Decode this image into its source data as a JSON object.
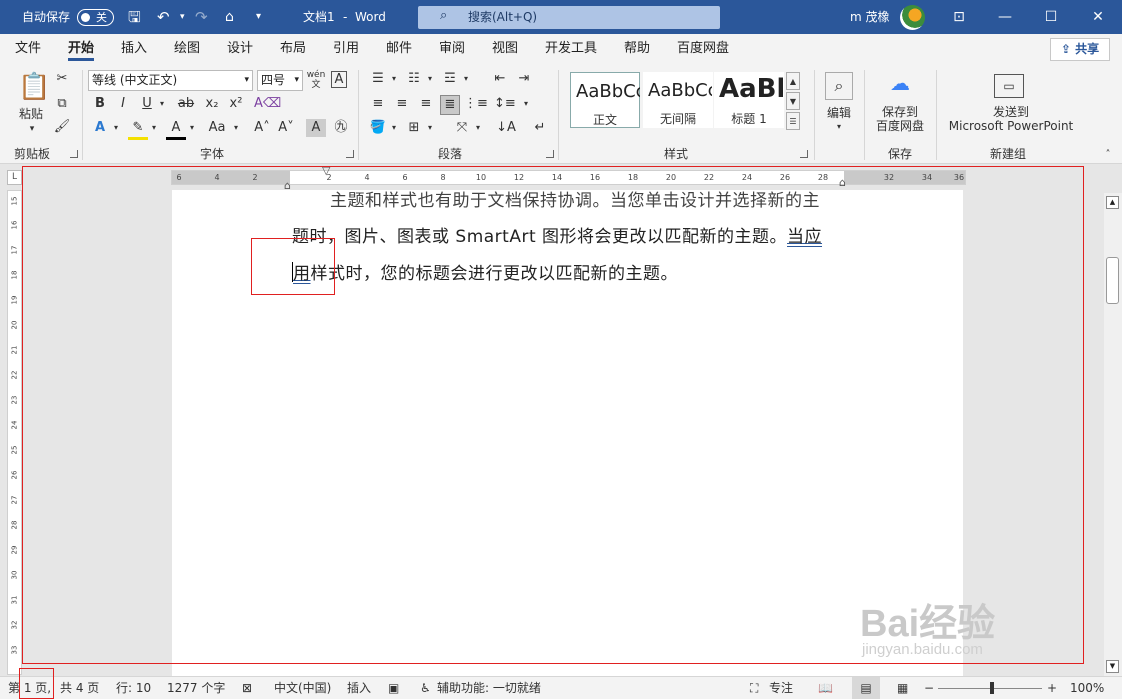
{
  "titlebar": {
    "autosave_label": "自动保存",
    "autosave_state": "关",
    "doc_title": "文档1",
    "separator": "-",
    "app_name": "Word",
    "search_placeholder": "搜索(Alt+Q)",
    "user_name": "m 茂橡"
  },
  "tabs": [
    "文件",
    "开始",
    "插入",
    "绘图",
    "设计",
    "布局",
    "引用",
    "邮件",
    "审阅",
    "视图",
    "开发工具",
    "帮助",
    "百度网盘"
  ],
  "share_label": "共享",
  "ribbon": {
    "clipboard": {
      "paste_label": "粘贴",
      "group_label": "剪贴板"
    },
    "font": {
      "font_name": "等线 (中文正文)",
      "font_size": "四号",
      "group_label": "字体",
      "bold": "B",
      "italic": "I",
      "underline": "U",
      "strike": "ab",
      "subscript": "x₂",
      "superscript": "x²",
      "change_case": "Aa"
    },
    "paragraph": {
      "group_label": "段落"
    },
    "styles": {
      "group_label": "样式",
      "items": [
        {
          "sample": "AaBbCcI",
          "name": "正文"
        },
        {
          "sample": "AaBbCcI",
          "name": "无间隔"
        },
        {
          "sample": "AaBl",
          "name": "标题 1"
        }
      ]
    },
    "editing": {
      "label": "编辑"
    },
    "save": {
      "label_line1": "保存到",
      "label_line2": "百度网盘",
      "group_label": "保存"
    },
    "new_group": {
      "label_line1": "发送到",
      "label_line2": "Microsoft PowerPoint",
      "group_label": "新建组"
    }
  },
  "ruler": {
    "h_ticks": [
      "6",
      "4",
      "2",
      "2",
      "4",
      "6",
      "8",
      "10",
      "12",
      "14",
      "16",
      "18",
      "20",
      "22",
      "24",
      "26",
      "28",
      "32",
      "34",
      "36"
    ],
    "v_ticks": [
      "15",
      "16",
      "17",
      "18",
      "19",
      "20",
      "21",
      "22",
      "23",
      "24",
      "25",
      "26",
      "27",
      "28",
      "29",
      "30",
      "31",
      "32",
      "33"
    ]
  },
  "document": {
    "line1": "主题和样式也有助于文档保持协调。当您单击设计并选择新的主",
    "line2_a": "题时，图片、图表或 SmartArt 图形将会更改以匹配新的主题。",
    "line2_b": "当应",
    "line3_a": "用",
    "line3_b": "样式时，您的标题会进行更改以匹配新的主题。"
  },
  "status": {
    "page_word": "第",
    "page_num": "1 页,",
    "total_pages": "共 4 页",
    "line": "行: 10",
    "words": "1277 个字",
    "language": "中文(中国)",
    "insert_mode": "插入",
    "accessibility": "辅助功能: 一切就绪",
    "focus": "专注",
    "zoom": "100%"
  },
  "watermark": {
    "main": "Bai经验",
    "sub": "jingyan.baidu.com"
  }
}
